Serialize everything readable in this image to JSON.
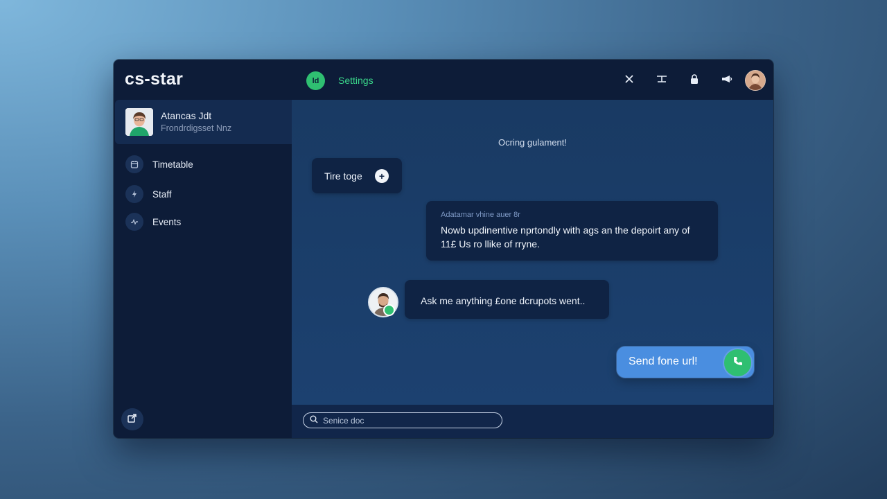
{
  "app": {
    "title": "cs-star"
  },
  "colors": {
    "accent_green": "#2fbf71",
    "send_blue": "#4a8ee0",
    "panel": "#0d1c38",
    "chat_bg": "#193a63"
  },
  "sidebar": {
    "profile": {
      "name": "Atancas Jdt",
      "subtitle": "Frondrdigsset Nnz"
    },
    "items": [
      {
        "label": "Timetable",
        "icon": "calendar-icon"
      },
      {
        "label": "Staff",
        "icon": "bolt-icon"
      },
      {
        "label": "Events",
        "icon": "activity-icon"
      }
    ],
    "bottom_icon": "share-icon"
  },
  "header": {
    "settings_label": "Settings",
    "settings_icon_text": "ld",
    "buttons": [
      "close-icon",
      "text-cursor-icon",
      "lock-icon",
      "megaphone-icon"
    ]
  },
  "chat": {
    "system_message": "Ocring gulament!",
    "messages": [
      {
        "text": "Tire toge"
      },
      {
        "meta": "Adatamar vhine auer 8r",
        "text": "Nowb updinentive nprtondly with ags an the depoirt any of 11£ Us ro llike of rryne."
      },
      {
        "text": "Ask me anything £one dcrupots went.."
      }
    ],
    "send_label": "Send fone url!"
  },
  "search": {
    "placeholder": "Senice doc"
  }
}
